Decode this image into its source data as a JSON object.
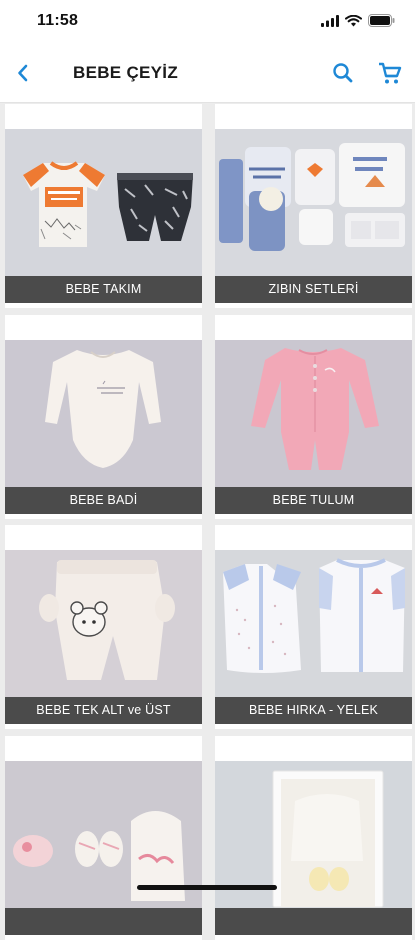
{
  "status": {
    "time": "11:58"
  },
  "nav": {
    "title": "BEBE ÇEYİZ"
  },
  "colors": {
    "accent": "#1e88d6",
    "label_bg": "#4b4b4b",
    "page_bg": "#ececec"
  },
  "icons": {
    "back": "chevron-left",
    "search": "search",
    "cart": "shopping-cart"
  },
  "categories": [
    {
      "label": "BEBE TAKIM"
    },
    {
      "label": "ZIBIN SETLERİ"
    },
    {
      "label": "BEBE BADİ"
    },
    {
      "label": "BEBE TULUM"
    },
    {
      "label": "BEBE TEK ALT ve ÜST"
    },
    {
      "label": "BEBE HIRKA - YELEK"
    },
    {
      "label": ""
    },
    {
      "label": ""
    }
  ]
}
